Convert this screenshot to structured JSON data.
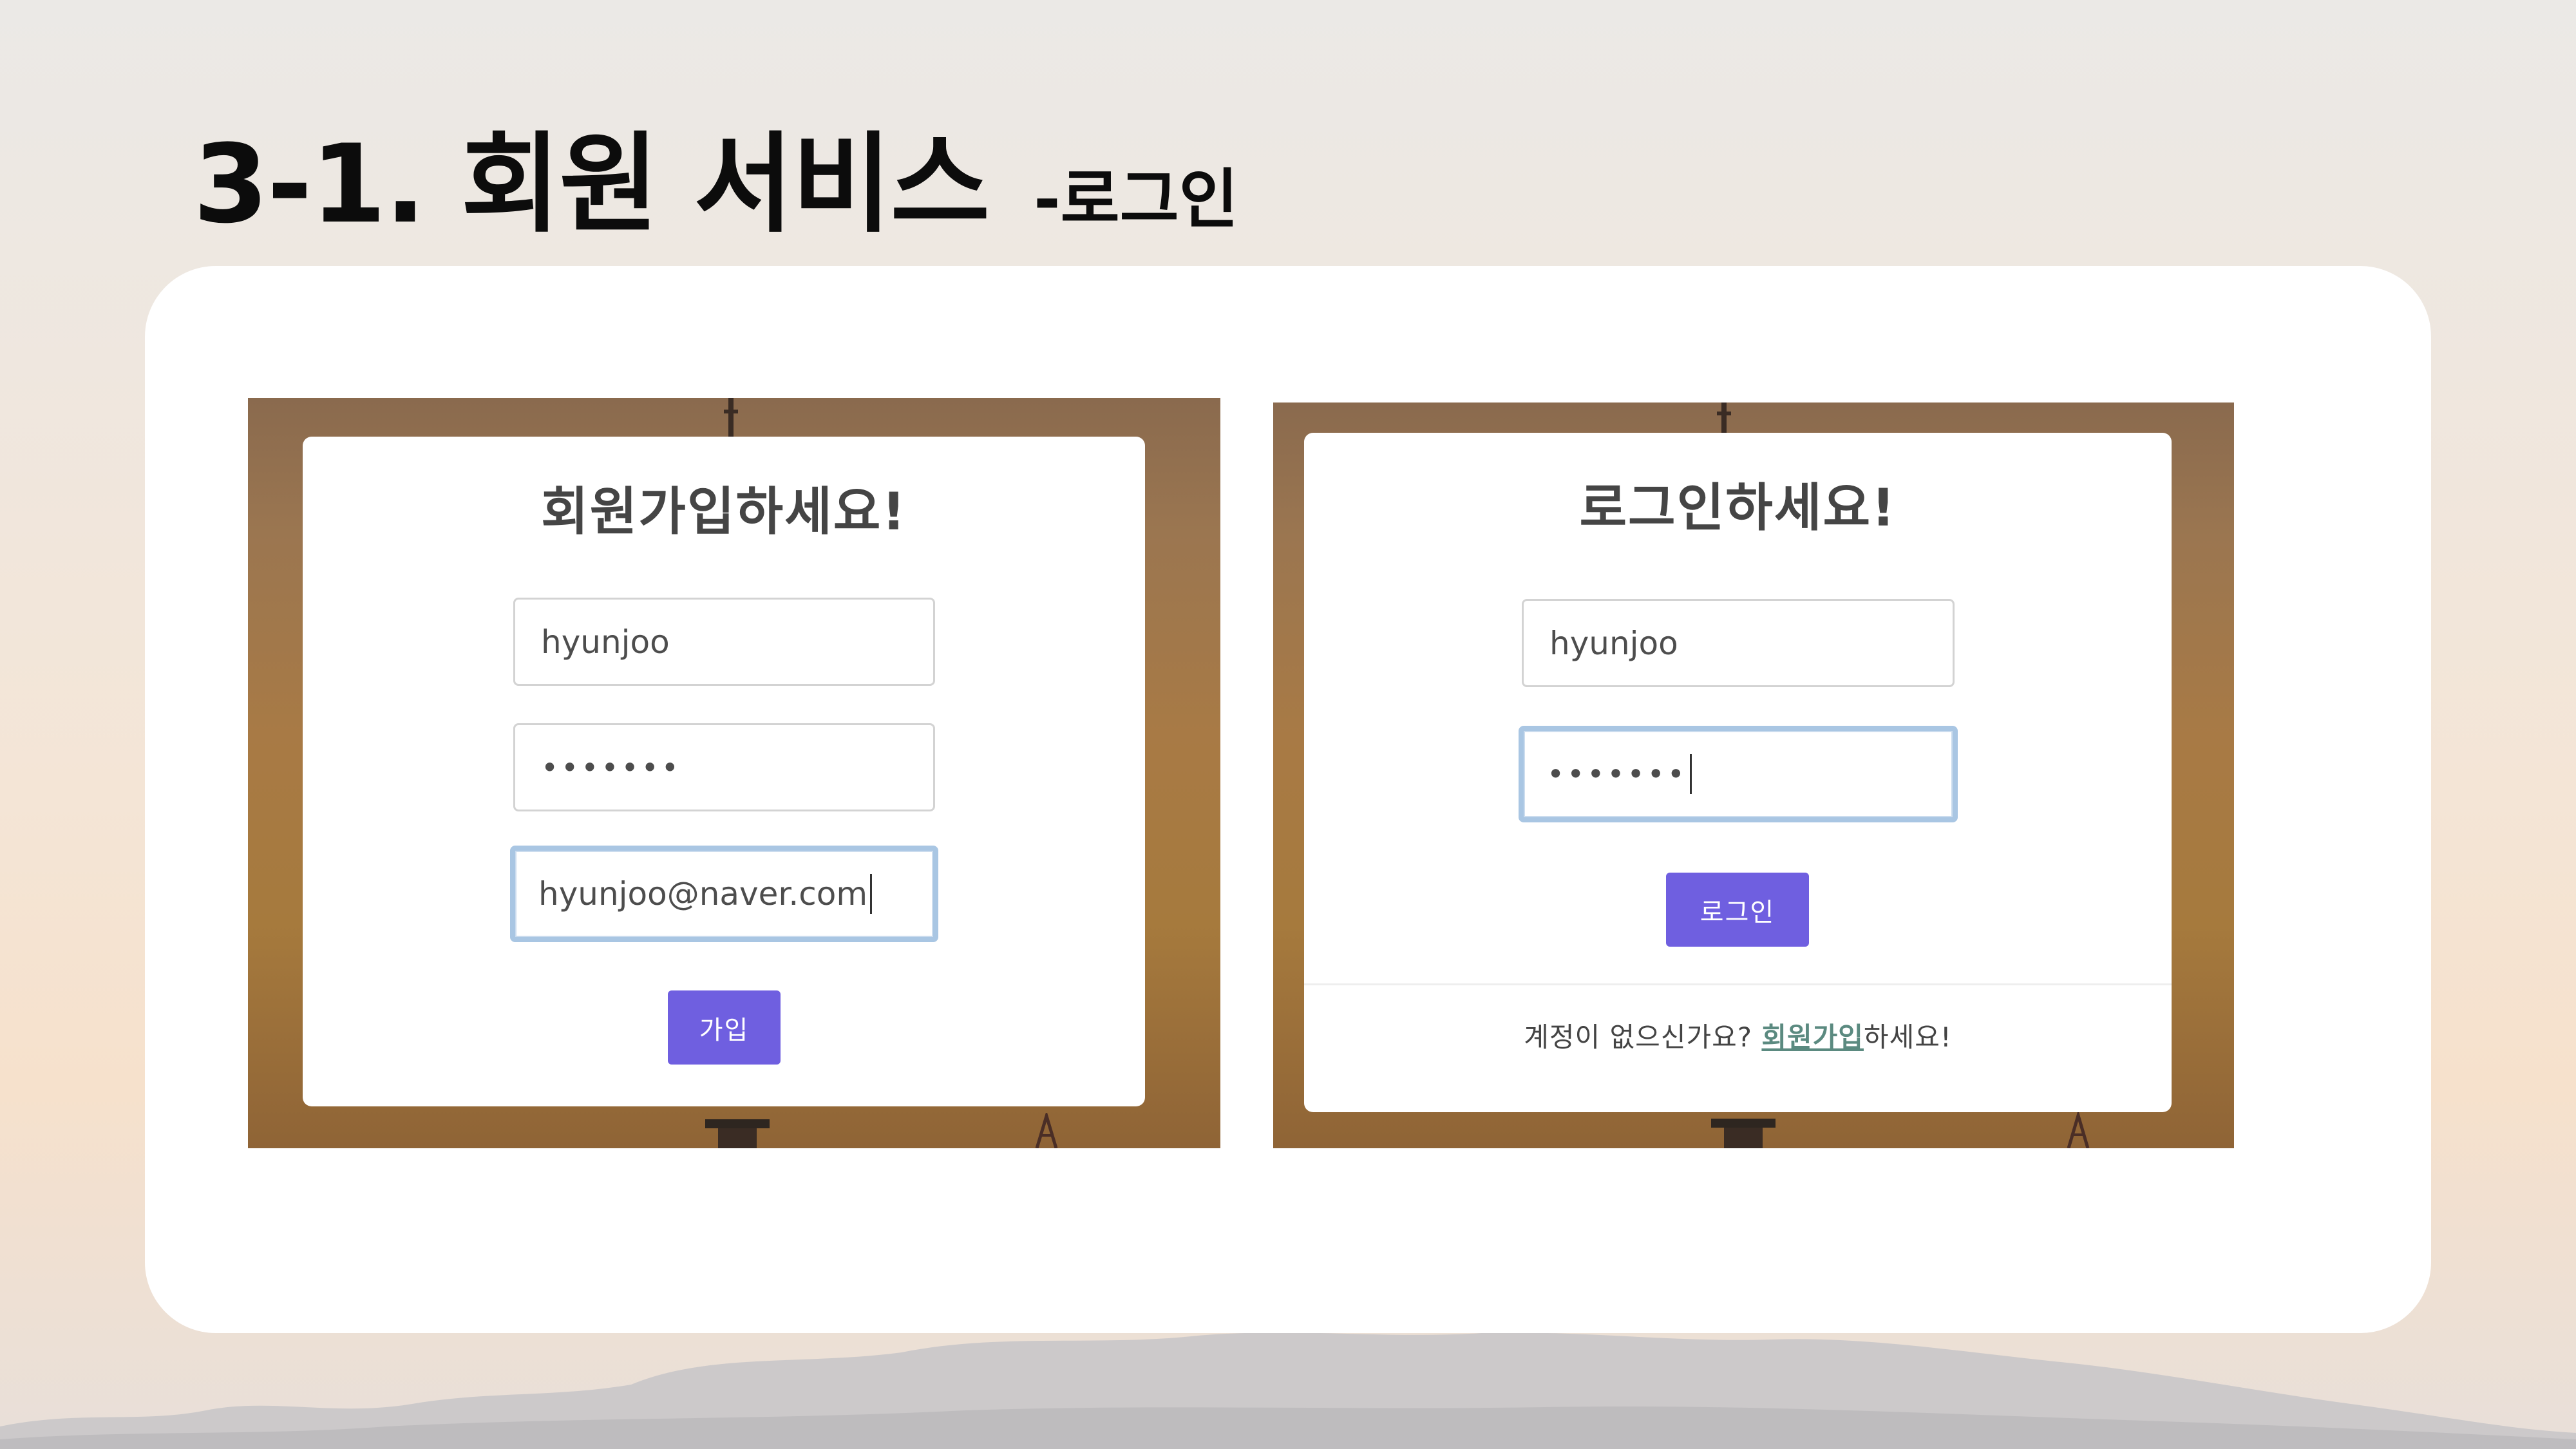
{
  "slide": {
    "title": "3-1. 회원 서비스",
    "subtitle": "-로그인"
  },
  "signup": {
    "heading": "회원가입하세요!",
    "username_value": "hyunjoo",
    "password_mask": "•••••••",
    "email_value": "hyunjoo@naver.com",
    "submit_label": "가입"
  },
  "login": {
    "heading": "로그인하세요!",
    "username_value": "hyunjoo",
    "password_mask": "•••••••",
    "submit_label": "로그인",
    "footer_prefix": "계정이 없으신가요? ",
    "footer_link": "회원가입",
    "footer_suffix": "하세요!"
  },
  "colors": {
    "button": "#6f5fe0",
    "link": "#5b8a80",
    "focus_border": "#a9c6e3"
  }
}
